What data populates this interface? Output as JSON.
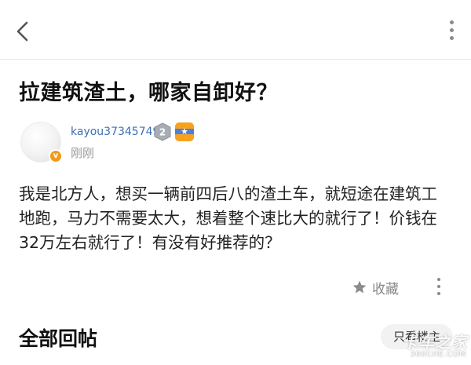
{
  "header": {
    "back_icon": "chevron-left-icon",
    "more_icon": "vertical-dots-icon"
  },
  "post": {
    "title": "拉建筑渣土，哪家自卸好？",
    "author": {
      "username": "kayou37345749",
      "avatar_badge": "v",
      "level": "2",
      "medal_icon": "medal-icon"
    },
    "timestamp": "刚刚",
    "body": "我是北方人，想买一辆前四后八的渣土车，就短途在建筑工地跑，马力不需要太大，想着整个速比大的就行了！价钱在32万左右就行了！有没有好推荐的？"
  },
  "actions": {
    "favorite_label": "收藏",
    "favorite_icon": "star-icon",
    "more_icon": "vertical-dots-icon"
  },
  "replies": {
    "section_title": "全部回帖",
    "only_op_label": "只看楼主"
  },
  "watermark": {
    "line1": "卡车之家",
    "line2": "360CHE.COM"
  },
  "colors": {
    "username": "#3c6fb3",
    "timestamp": "#9a9a9a",
    "badge_orange": "#f39a1d",
    "medal_blue": "#4b7fe0"
  }
}
